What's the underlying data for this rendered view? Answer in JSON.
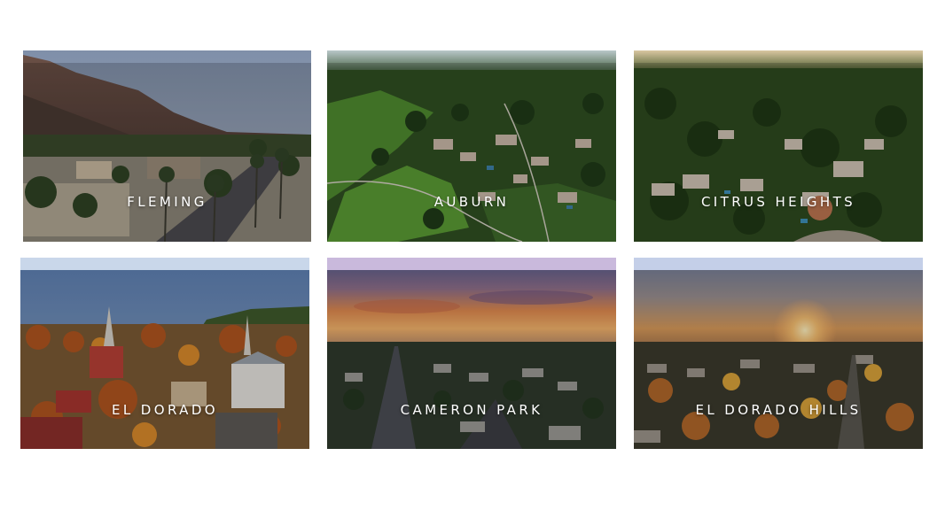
{
  "locations": [
    {
      "name": "FLEMING"
    },
    {
      "name": "AUBURN"
    },
    {
      "name": "CITRUS HEIGHTS"
    },
    {
      "name": "EL DORADO"
    },
    {
      "name": "CAMERON PARK"
    },
    {
      "name": "EL DORADO HILLS"
    }
  ]
}
